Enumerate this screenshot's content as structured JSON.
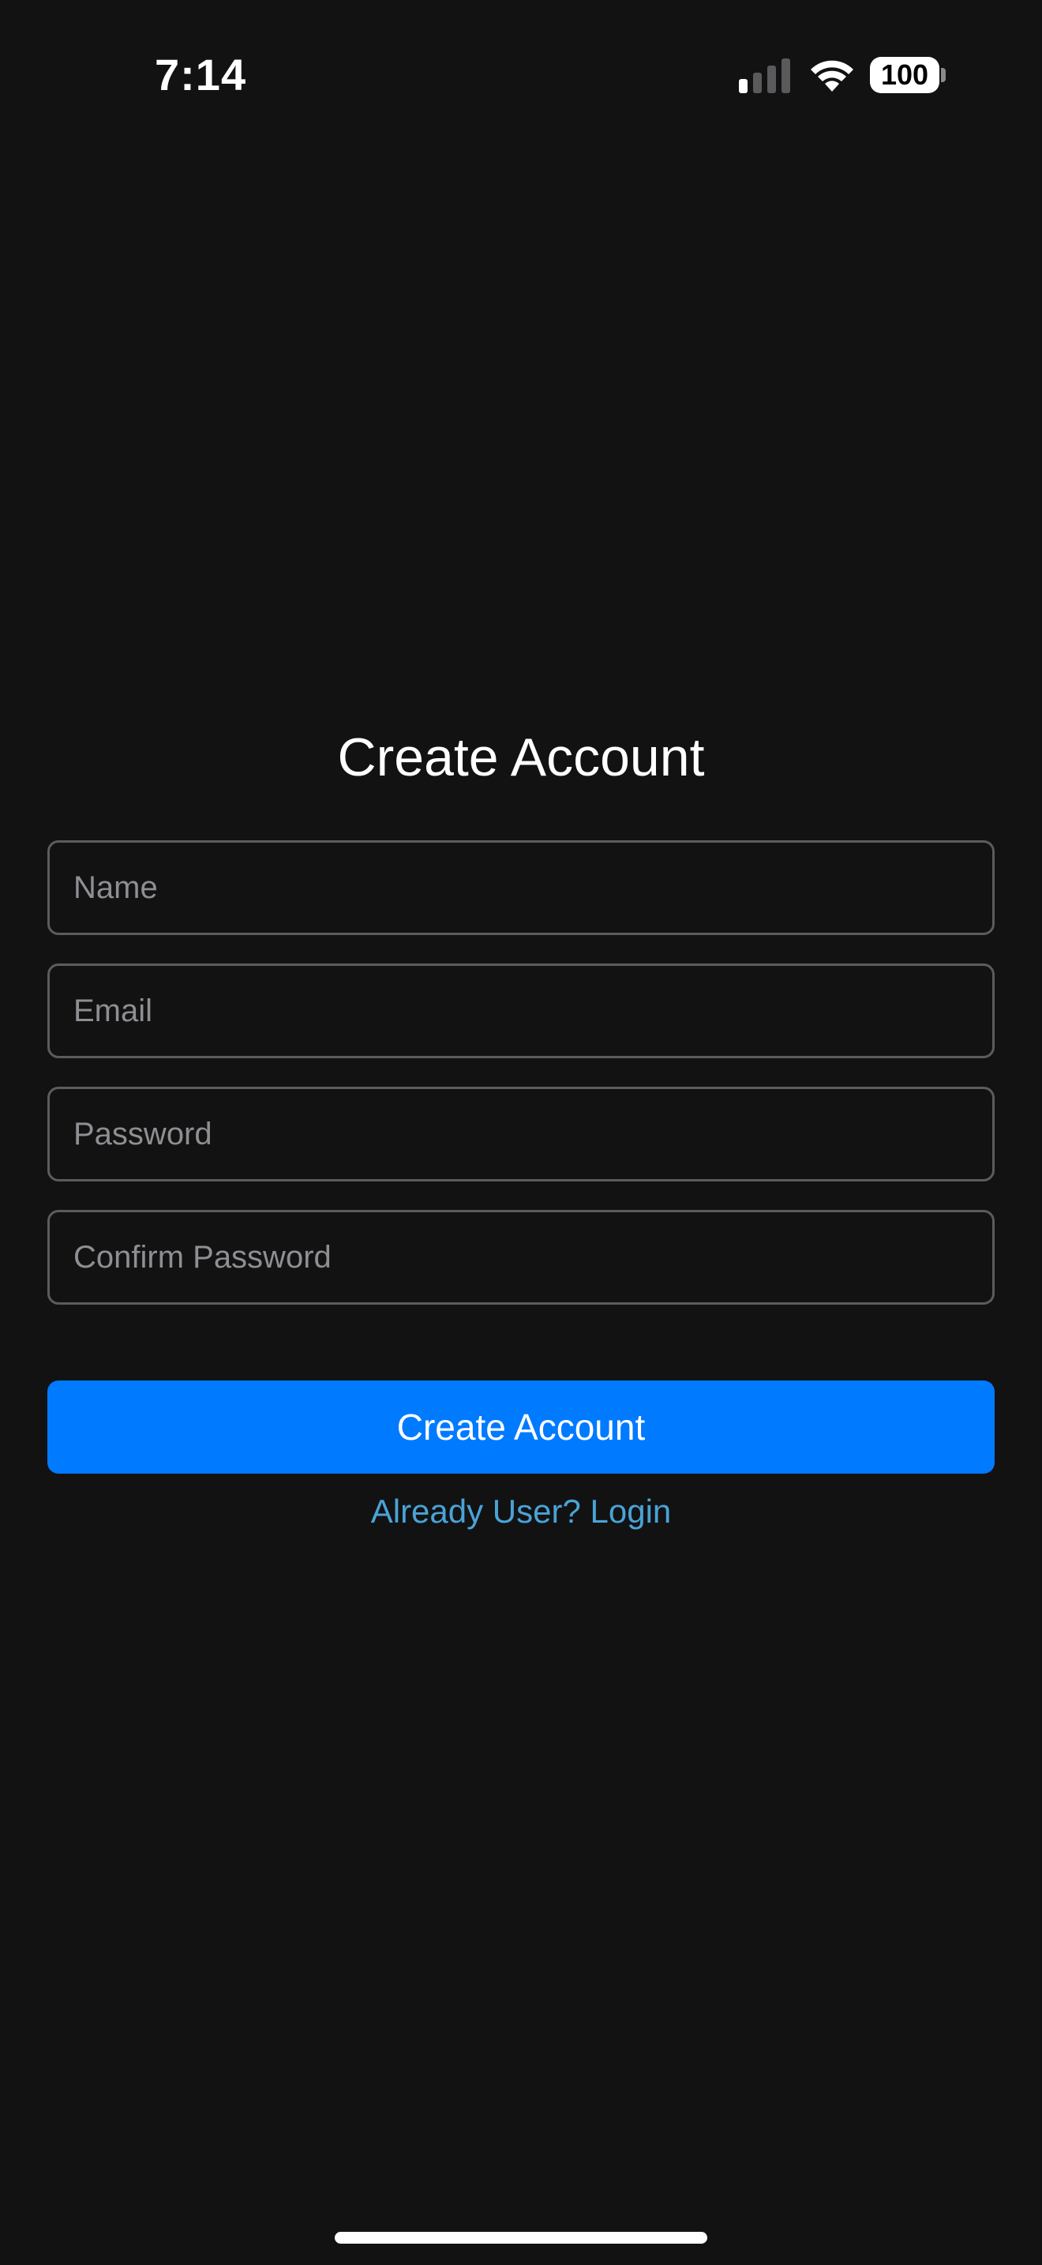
{
  "status_bar": {
    "time": "7:14",
    "signal_bars_active": 1,
    "signal_bars_total": 4,
    "wifi_icon": "wifi-icon",
    "battery_level": "100"
  },
  "form": {
    "title": "Create Account",
    "fields": {
      "name": {
        "placeholder": "Name",
        "value": ""
      },
      "email": {
        "placeholder": "Email",
        "value": ""
      },
      "password": {
        "placeholder": "Password",
        "value": ""
      },
      "confirm_password": {
        "placeholder": "Confirm Password",
        "value": ""
      }
    },
    "submit_label": "Create Account",
    "login_link_label": "Already User? Login"
  },
  "colors": {
    "background": "#121213",
    "primary_button": "#007aff",
    "link": "#4aa3d6",
    "field_border": "#5c5c5e",
    "placeholder": "#8e8e93"
  }
}
